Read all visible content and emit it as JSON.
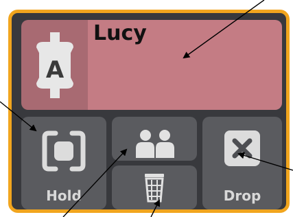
{
  "contact": {
    "name": "Lucy",
    "avatar_letter": "A"
  },
  "buttons": {
    "hold_label": "Hold",
    "drop_label": "Drop"
  },
  "icons": {
    "avatar": "person-tag-icon",
    "hold": "hold-bracket-icon",
    "partner": "two-people-icon",
    "trash": "trash-can-icon",
    "drop": "close-x-icon"
  },
  "colors": {
    "frame_border": "#f1a51e",
    "name_tile": "#c47c84",
    "avatar_tile": "#a86a72",
    "button_tile": "#5a5b5f"
  }
}
